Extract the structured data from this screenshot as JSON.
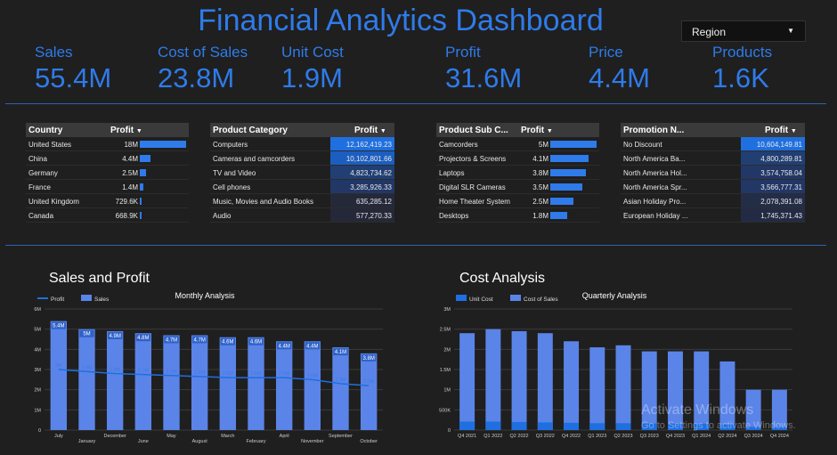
{
  "header": {
    "title": "Financial Analytics Dashboard",
    "region_filter": "Region"
  },
  "kpis": [
    {
      "label": "Sales",
      "value": "55.4M"
    },
    {
      "label": "Cost of Sales",
      "value": "23.8M"
    },
    {
      "label": "Unit Cost",
      "value": "1.9M"
    },
    {
      "label": "Profit",
      "value": "31.6M"
    },
    {
      "label": "Price",
      "value": "4.4M"
    },
    {
      "label": "Products",
      "value": "1.6K"
    }
  ],
  "tables": {
    "country": {
      "col1": "Country",
      "col2": "Profit",
      "rows": [
        {
          "name": "United States",
          "value": "18M",
          "frac": 1.0
        },
        {
          "name": "China",
          "value": "4.4M",
          "frac": 0.24
        },
        {
          "name": "Germany",
          "value": "2.5M",
          "frac": 0.14
        },
        {
          "name": "France",
          "value": "1.4M",
          "frac": 0.08
        },
        {
          "name": "United Kingdom",
          "value": "729.6K",
          "frac": 0.04
        },
        {
          "name": "Canada",
          "value": "668.9K",
          "frac": 0.037
        }
      ]
    },
    "category": {
      "col1": "Product Category",
      "col2": "Profit",
      "rows": [
        {
          "name": "Computers",
          "value": "12,162,419.23",
          "shade": "#1f6fe0"
        },
        {
          "name": "Cameras and camcorders",
          "value": "10,102,801.66",
          "shade": "#1c5ec0"
        },
        {
          "name": "TV and Video",
          "value": "4,823,734.62",
          "shade": "#213f72"
        },
        {
          "name": "Cell phones",
          "value": "3,285,926.33",
          "shade": "#223766"
        },
        {
          "name": "Music, Movies and Audio Books",
          "value": "635,285.12",
          "shade": "#24293a"
        },
        {
          "name": "Audio",
          "value": "577,270.33",
          "shade": "#242838"
        }
      ]
    },
    "subcategory": {
      "col1": "Product Sub C...",
      "col2": "Profit",
      "rows": [
        {
          "name": "Camcorders",
          "value": "5M",
          "frac": 1.0
        },
        {
          "name": "Projectors & Screens",
          "value": "4.1M",
          "frac": 0.82
        },
        {
          "name": "Laptops",
          "value": "3.8M",
          "frac": 0.76
        },
        {
          "name": "Digital SLR Cameras",
          "value": "3.5M",
          "frac": 0.7
        },
        {
          "name": "Home Theater System",
          "value": "2.5M",
          "frac": 0.5
        },
        {
          "name": "Desktops",
          "value": "1.8M",
          "frac": 0.36
        }
      ]
    },
    "promotion": {
      "col1": "Promotion N...",
      "col2": "Profit",
      "rows": [
        {
          "name": "No Discount",
          "value": "10,604,149.81",
          "shade": "#1f6fe0"
        },
        {
          "name": "North America Ba...",
          "value": "4,800,289.81",
          "shade": "#213f72"
        },
        {
          "name": "North America Hol...",
          "value": "3,574,758.04",
          "shade": "#223766"
        },
        {
          "name": "North America Spr...",
          "value": "3,566,777.31",
          "shade": "#223766"
        },
        {
          "name": "Asian Holiday Pro...",
          "value": "2,078,391.08",
          "shade": "#232d48"
        },
        {
          "name": "European Holiday ...",
          "value": "1,745,371.43",
          "shade": "#232b44"
        }
      ]
    }
  },
  "chart_data": [
    {
      "type": "bar",
      "title": "Sales and Profit",
      "subtitle": "Monthly Analysis",
      "categories": [
        "July",
        "January",
        "December",
        "June",
        "May",
        "August",
        "March",
        "February",
        "April",
        "November",
        "September",
        "October"
      ],
      "series": [
        {
          "name": "Sales",
          "kind": "bar",
          "color": "#5b84e8",
          "values": [
            5.4,
            5.0,
            4.9,
            4.8,
            4.7,
            4.7,
            4.6,
            4.6,
            4.4,
            4.4,
            4.1,
            3.8
          ],
          "labels": [
            "5.4M",
            "5M",
            "4.9M",
            "4.8M",
            "4.7M",
            "4.7M",
            "4.6M",
            "4.6M",
            "4.4M",
            "4.4M",
            "4.1M",
            "3.8M"
          ]
        },
        {
          "name": "Profit",
          "kind": "line",
          "color": "#1f6fe0",
          "values": [
            3.0,
            2.9,
            2.8,
            2.75,
            2.7,
            2.65,
            2.6,
            2.6,
            2.6,
            2.5,
            2.3,
            2.2
          ],
          "labels": [
            "3M",
            "2.9M",
            "2.8M",
            "2.7M",
            "2.7M",
            "2.6M",
            "2.6M",
            "2.6M",
            "2.6M",
            "2.5M",
            "2.3M",
            "2.2M"
          ]
        }
      ],
      "yticks": [
        "0",
        "1M",
        "2M",
        "3M",
        "4M",
        "5M",
        "6M"
      ],
      "ylim": [
        0,
        6
      ],
      "legend": "top-left"
    },
    {
      "type": "bar",
      "title": "Cost Analysis",
      "subtitle": "Quarterly Analysis",
      "categories": [
        "Q4 2021",
        "Q1 2022",
        "Q2 2022",
        "Q3 2022",
        "Q4 2022",
        "Q1 2023",
        "Q2 2023",
        "Q3 2023",
        "Q4 2023",
        "Q1 2024",
        "Q2 2024",
        "Q3 2024",
        "Q4 2024"
      ],
      "series": [
        {
          "name": "Cost of Sales",
          "kind": "bar",
          "color": "#5b84e8",
          "values": [
            2.4,
            2.5,
            2.45,
            2.4,
            2.2,
            2.05,
            2.1,
            1.95,
            1.95,
            1.95,
            1.7,
            1.0,
            1.0
          ]
        },
        {
          "name": "Unit Cost",
          "kind": "bar",
          "color": "#1f6fe0",
          "values": [
            0.21,
            0.21,
            0.2,
            0.19,
            0.18,
            0.17,
            0.17,
            0.16,
            0.16,
            0.16,
            0.14,
            0.08,
            0.08
          ]
        }
      ],
      "yticks": [
        "0",
        "500K",
        "1M",
        "1.5M",
        "2M",
        "2.5M",
        "3M"
      ],
      "ylim": [
        0,
        3
      ],
      "legend": "top-left"
    }
  ],
  "watermark": {
    "line1": "Activate Windows",
    "line2": "Go to Settings to activate Windows."
  }
}
